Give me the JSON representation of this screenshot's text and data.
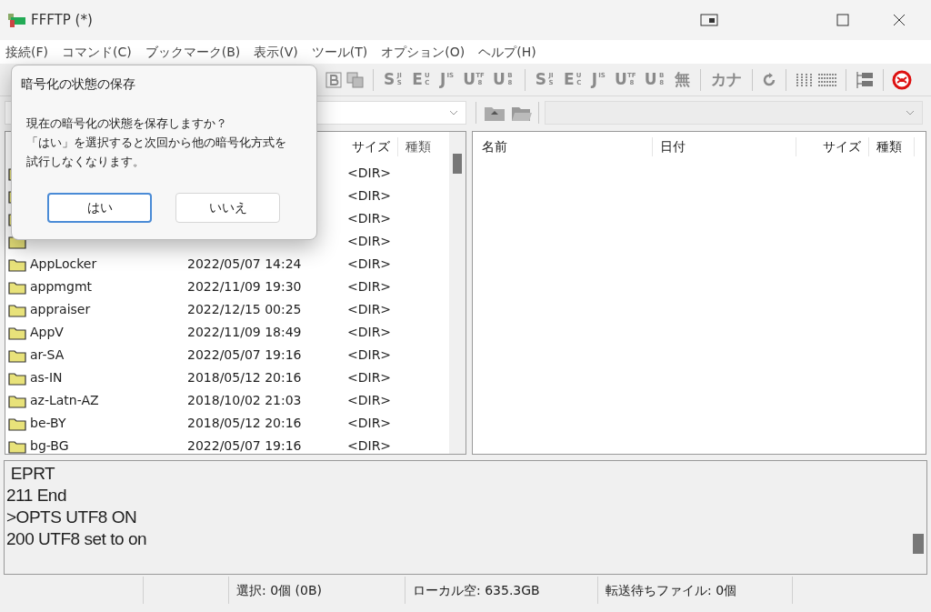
{
  "window": {
    "title": "FFFTP (*)"
  },
  "menu": [
    "接続(F)",
    "コマンド(C)",
    "ブックマーク(B)",
    "表示(V)",
    "ツール(T)",
    "オプション(O)",
    "ヘルプ(H)"
  ],
  "toolbar": [
    {
      "kind": "icon"
    },
    {
      "kind": "icon"
    },
    {
      "kind": "sep"
    },
    {
      "kind": "glyph",
      "main": "S",
      "small": "JIS"
    },
    {
      "kind": "glyph",
      "main": "E",
      "small": "UC"
    },
    {
      "kind": "glyph",
      "main": "J",
      "small": "IS"
    },
    {
      "kind": "glyph",
      "main": "U",
      "small": "TF8"
    },
    {
      "kind": "glyph",
      "main": "U",
      "small": "B8"
    },
    {
      "kind": "sep"
    },
    {
      "kind": "glyph",
      "main": "S",
      "small": "JIS"
    },
    {
      "kind": "glyph",
      "main": "E",
      "small": "UC"
    },
    {
      "kind": "glyph",
      "main": "J",
      "small": "IS"
    },
    {
      "kind": "glyph",
      "main": "U",
      "small": "TF8"
    },
    {
      "kind": "glyph",
      "main": "U",
      "small": "B8"
    },
    {
      "kind": "glyph",
      "main": "無"
    },
    {
      "kind": "sep"
    },
    {
      "kind": "glyph",
      "main": "カナ"
    },
    {
      "kind": "sep"
    },
    {
      "kind": "icon"
    },
    {
      "kind": "sep"
    },
    {
      "kind": "icon"
    },
    {
      "kind": "icon"
    },
    {
      "kind": "sep"
    },
    {
      "kind": "icon"
    },
    {
      "kind": "sep"
    },
    {
      "kind": "icon"
    }
  ],
  "local": {
    "columns": [
      "サイズ",
      "種類"
    ],
    "rows": [
      {
        "name": "",
        "date": "",
        "size": "<DIR>"
      },
      {
        "name": "",
        "date": "",
        "size": "<DIR>"
      },
      {
        "name": "",
        "date": "",
        "size": "<DIR>"
      },
      {
        "name": "",
        "date": "",
        "size": "<DIR>"
      },
      {
        "name": "AppLocker",
        "date": "2022/05/07 14:24",
        "size": "<DIR>"
      },
      {
        "name": "appmgmt",
        "date": "2022/11/09 19:30",
        "size": "<DIR>"
      },
      {
        "name": "appraiser",
        "date": "2022/12/15 00:25",
        "size": "<DIR>"
      },
      {
        "name": "AppV",
        "date": "2022/11/09 18:49",
        "size": "<DIR>"
      },
      {
        "name": "ar-SA",
        "date": "2022/05/07 19:16",
        "size": "<DIR>"
      },
      {
        "name": "as-IN",
        "date": "2018/05/12 20:16",
        "size": "<DIR>"
      },
      {
        "name": "az-Latn-AZ",
        "date": "2018/10/02 21:03",
        "size": "<DIR>"
      },
      {
        "name": "be-BY",
        "date": "2018/05/12 20:16",
        "size": "<DIR>"
      },
      {
        "name": "bg-BG",
        "date": "2022/05/07 19:16",
        "size": "<DIR>"
      }
    ]
  },
  "remote": {
    "columns": [
      "名前",
      "日付",
      "サイズ",
      "種類"
    ]
  },
  "log": [
    " EPRT",
    "211 End",
    ">OPTS UTF8 ON",
    "200 UTF8 set to on"
  ],
  "status_bar": [
    "選択: 0個 (0B)",
    "ローカル空: 635.3GB",
    "転送待ちファイル: 0個"
  ],
  "dialog": {
    "title": "暗号化の状態の保存",
    "message": [
      "現在の暗号化の状態を保存しますか？",
      "「はい」を選択すると次回から他の暗号化方式を",
      "試行しなくなります。"
    ],
    "buttons": [
      {
        "label": "はい",
        "selected": true
      },
      {
        "label": "いいえ",
        "selected": false
      }
    ]
  }
}
